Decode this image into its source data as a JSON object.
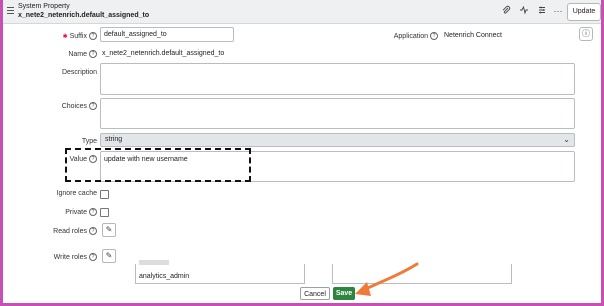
{
  "header": {
    "title": "System Property",
    "subtitle": "x_nete2_netenrich.default_assigned_to",
    "update_label": "Update",
    "icons": [
      "paperclip-icon",
      "activity-icon",
      "sliders-icon",
      "more-icon"
    ]
  },
  "form": {
    "suffix_label": "Suffix",
    "suffix_value": "default_assigned_to",
    "application_label": "Application",
    "application_value": "Netenrich Connect",
    "name_label": "Name",
    "name_value": "x_nete2_netenrich.default_assigned_to",
    "description_label": "Description",
    "choices_label": "Choices",
    "type_label": "Type",
    "type_value": "string",
    "value_label": "Value",
    "value_text": "update with new username",
    "ignore_cache_label": "Ignore cache",
    "private_label": "Private",
    "read_roles_label": "Read roles",
    "write_roles_label": "Write roles",
    "roles_list": [
      "analytics_admin"
    ]
  },
  "footer": {
    "cancel_label": "Cancel",
    "save_label": "Save"
  },
  "colors": {
    "accent_green": "#2e8540",
    "annotation_orange": "#f07a3a",
    "frame_border": "#c84fb4"
  }
}
